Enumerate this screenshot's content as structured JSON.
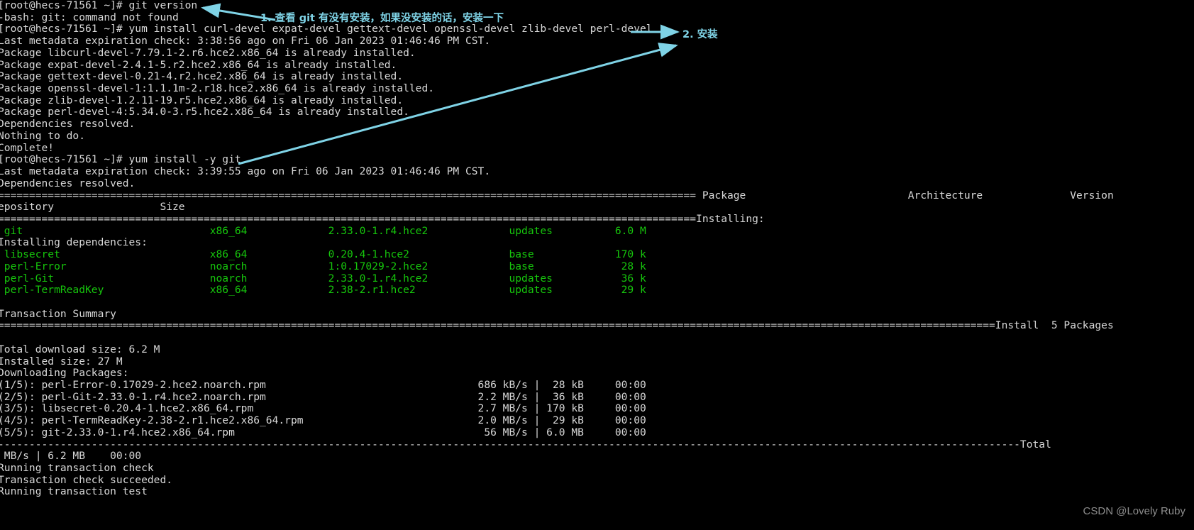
{
  "terminal": {
    "prompt_user": "root",
    "prompt_host": "hecs-71561",
    "foreground_color": "#d8d8d8",
    "background_color": "#000000",
    "package_color": "#16c60c",
    "lines": [
      {
        "text": "[root@hecs-71561 ~]# git version",
        "color": "white"
      },
      {
        "text": "-bash: git: command not found",
        "color": "white"
      },
      {
        "text": "[root@hecs-71561 ~]# yum install curl-devel expat-devel gettext-devel openssl-devel zlib-devel perl-devel",
        "color": "white"
      },
      {
        "text": "Last metadata expiration check: 3:38:56 ago on Fri 06 Jan 2023 01:46:46 PM CST.",
        "color": "white"
      },
      {
        "text": "Package libcurl-devel-7.79.1-2.r6.hce2.x86_64 is already installed.",
        "color": "white"
      },
      {
        "text": "Package expat-devel-2.4.1-5.r2.hce2.x86_64 is already installed.",
        "color": "white"
      },
      {
        "text": "Package gettext-devel-0.21-4.r2.hce2.x86_64 is already installed.",
        "color": "white"
      },
      {
        "text": "Package openssl-devel-1:1.1.1m-2.r18.hce2.x86_64 is already installed.",
        "color": "white"
      },
      {
        "text": "Package zlib-devel-1.2.11-19.r5.hce2.x86_64 is already installed.",
        "color": "white"
      },
      {
        "text": "Package perl-devel-4:5.34.0-3.r5.hce2.x86_64 is already installed.",
        "color": "white"
      },
      {
        "text": "Dependencies resolved.",
        "color": "white"
      },
      {
        "text": "Nothing to do.",
        "color": "white"
      },
      {
        "text": "Complete!",
        "color": "white"
      },
      {
        "text": "[root@hecs-71561 ~]# yum install -y git",
        "color": "white"
      },
      {
        "text": "Last metadata expiration check: 3:39:55 ago on Fri 06 Jan 2023 01:46:46 PM CST.",
        "color": "white"
      },
      {
        "text": "Dependencies resolved.",
        "color": "white"
      },
      {
        "text": "================================================================================================================ Package                          Architecture              Version",
        "color": "white"
      },
      {
        "text": "epository                 Size",
        "color": "white"
      },
      {
        "text": "================================================================================================================Installing:",
        "color": "white"
      },
      {
        "text": " git                              x86_64             2.33.0-1.r4.hce2             updates          6.0 M",
        "color": "green"
      },
      {
        "text": "Installing dependencies:",
        "color": "white"
      },
      {
        "text": " libsecret                        x86_64             0.20.4-1.hce2                base             170 k",
        "color": "green"
      },
      {
        "text": " perl-Error                       noarch             1:0.17029-2.hce2             base              28 k",
        "color": "green"
      },
      {
        "text": " perl-Git                         noarch             2.33.0-1.r4.hce2             updates           36 k",
        "color": "green"
      },
      {
        "text": " perl-TermReadKey                 x86_64             2.38-2.r1.hce2               updates           29 k",
        "color": "green"
      },
      {
        "text": "",
        "color": "white"
      },
      {
        "text": "Transaction Summary",
        "color": "white"
      },
      {
        "text": "================================================================================================================================================================Install  5 Packages",
        "color": "white"
      },
      {
        "text": "",
        "color": "white"
      },
      {
        "text": "Total download size: 6.2 M",
        "color": "white"
      },
      {
        "text": "Installed size: 27 M",
        "color": "white"
      },
      {
        "text": "Downloading Packages:",
        "color": "white"
      },
      {
        "text": "(1/5): perl-Error-0.17029-2.hce2.noarch.rpm                                  686 kB/s |  28 kB     00:00",
        "color": "white"
      },
      {
        "text": "(2/5): perl-Git-2.33.0-1.r4.hce2.noarch.rpm                                  2.2 MB/s |  36 kB     00:00",
        "color": "white"
      },
      {
        "text": "(3/5): libsecret-0.20.4-1.hce2.x86_64.rpm                                    2.7 MB/s | 170 kB     00:00",
        "color": "white"
      },
      {
        "text": "(4/5): perl-TermReadKey-2.38-2.r1.hce2.x86_64.rpm                            2.0 MB/s |  29 kB     00:00",
        "color": "white"
      },
      {
        "text": "(5/5): git-2.33.0-1.r4.hce2.x86_64.rpm                                        56 MB/s | 6.0 MB     00:00",
        "color": "white"
      },
      {
        "text": "--------------------------------------------------------------------------------------------------------------------------------------------------------------------Total",
        "color": "white"
      },
      {
        "text": " MB/s | 6.2 MB    00:00",
        "color": "white"
      },
      {
        "text": "Running transaction check",
        "color": "white"
      },
      {
        "text": "Transaction check succeeded.",
        "color": "white"
      },
      {
        "text": "Running transaction test",
        "color": "white"
      }
    ],
    "package_table": {
      "headers": [
        "Package",
        "Architecture",
        "Version",
        "Repository",
        "Size"
      ],
      "installing_label": "Installing:",
      "installing_deps_label": "Installing dependencies:",
      "rows": [
        {
          "package": "git",
          "architecture": "x86_64",
          "version": "2.33.0-1.r4.hce2",
          "repository": "updates",
          "size": "6.0 M",
          "group": "Installing"
        },
        {
          "package": "libsecret",
          "architecture": "x86_64",
          "version": "0.20.4-1.hce2",
          "repository": "base",
          "size": "170 k",
          "group": "Installing dependencies"
        },
        {
          "package": "perl-Error",
          "architecture": "noarch",
          "version": "1:0.17029-2.hce2",
          "repository": "base",
          "size": "28 k",
          "group": "Installing dependencies"
        },
        {
          "package": "perl-Git",
          "architecture": "noarch",
          "version": "2.33.0-1.r4.hce2",
          "repository": "updates",
          "size": "36 k",
          "group": "Installing dependencies"
        },
        {
          "package": "perl-TermReadKey",
          "architecture": "x86_64",
          "version": "2.38-2.r1.hce2",
          "repository": "updates",
          "size": "29 k",
          "group": "Installing dependencies"
        }
      ]
    },
    "transaction_summary": {
      "title": "Transaction Summary",
      "install_count": "Install  5 Packages",
      "total_download_size": "Total download size: 6.2 M",
      "installed_size": "Installed size: 27 M"
    },
    "downloads": {
      "title": "Downloading Packages:",
      "items": [
        {
          "index": "(1/5)",
          "file": "perl-Error-0.17029-2.hce2.noarch.rpm",
          "rate": "686 kB/s",
          "size": "28 kB",
          "time": "00:00"
        },
        {
          "index": "(2/5)",
          "file": "perl-Git-2.33.0-1.r4.hce2.noarch.rpm",
          "rate": "2.2 MB/s",
          "size": "36 kB",
          "time": "00:00"
        },
        {
          "index": "(3/5)",
          "file": "libsecret-0.20.4-1.hce2.x86_64.rpm",
          "rate": "2.7 MB/s",
          "size": "170 kB",
          "time": "00:00"
        },
        {
          "index": "(4/5)",
          "file": "perl-TermReadKey-2.38-2.r1.hce2.x86_64.rpm",
          "rate": "2.0 MB/s",
          "size": "29 kB",
          "time": "00:00"
        },
        {
          "index": "(5/5)",
          "file": "git-2.33.0-1.r4.hce2.x86_64.rpm",
          "rate": "56 MB/s",
          "size": "6.0 MB",
          "time": "00:00"
        }
      ],
      "total_label": "Total",
      "total_line": " MB/s | 6.2 MB    00:00"
    },
    "status_lines": [
      "Running transaction check",
      "Transaction check succeeded.",
      "Running transaction test"
    ]
  },
  "annotations": {
    "color": "#7fd3e6",
    "items": [
      {
        "label": "1. 查看 git 有没有安装，如果没安装的话，安装一下"
      },
      {
        "label": "2. 安装"
      }
    ]
  },
  "watermark": {
    "text": "CSDN @Lovely Ruby"
  }
}
